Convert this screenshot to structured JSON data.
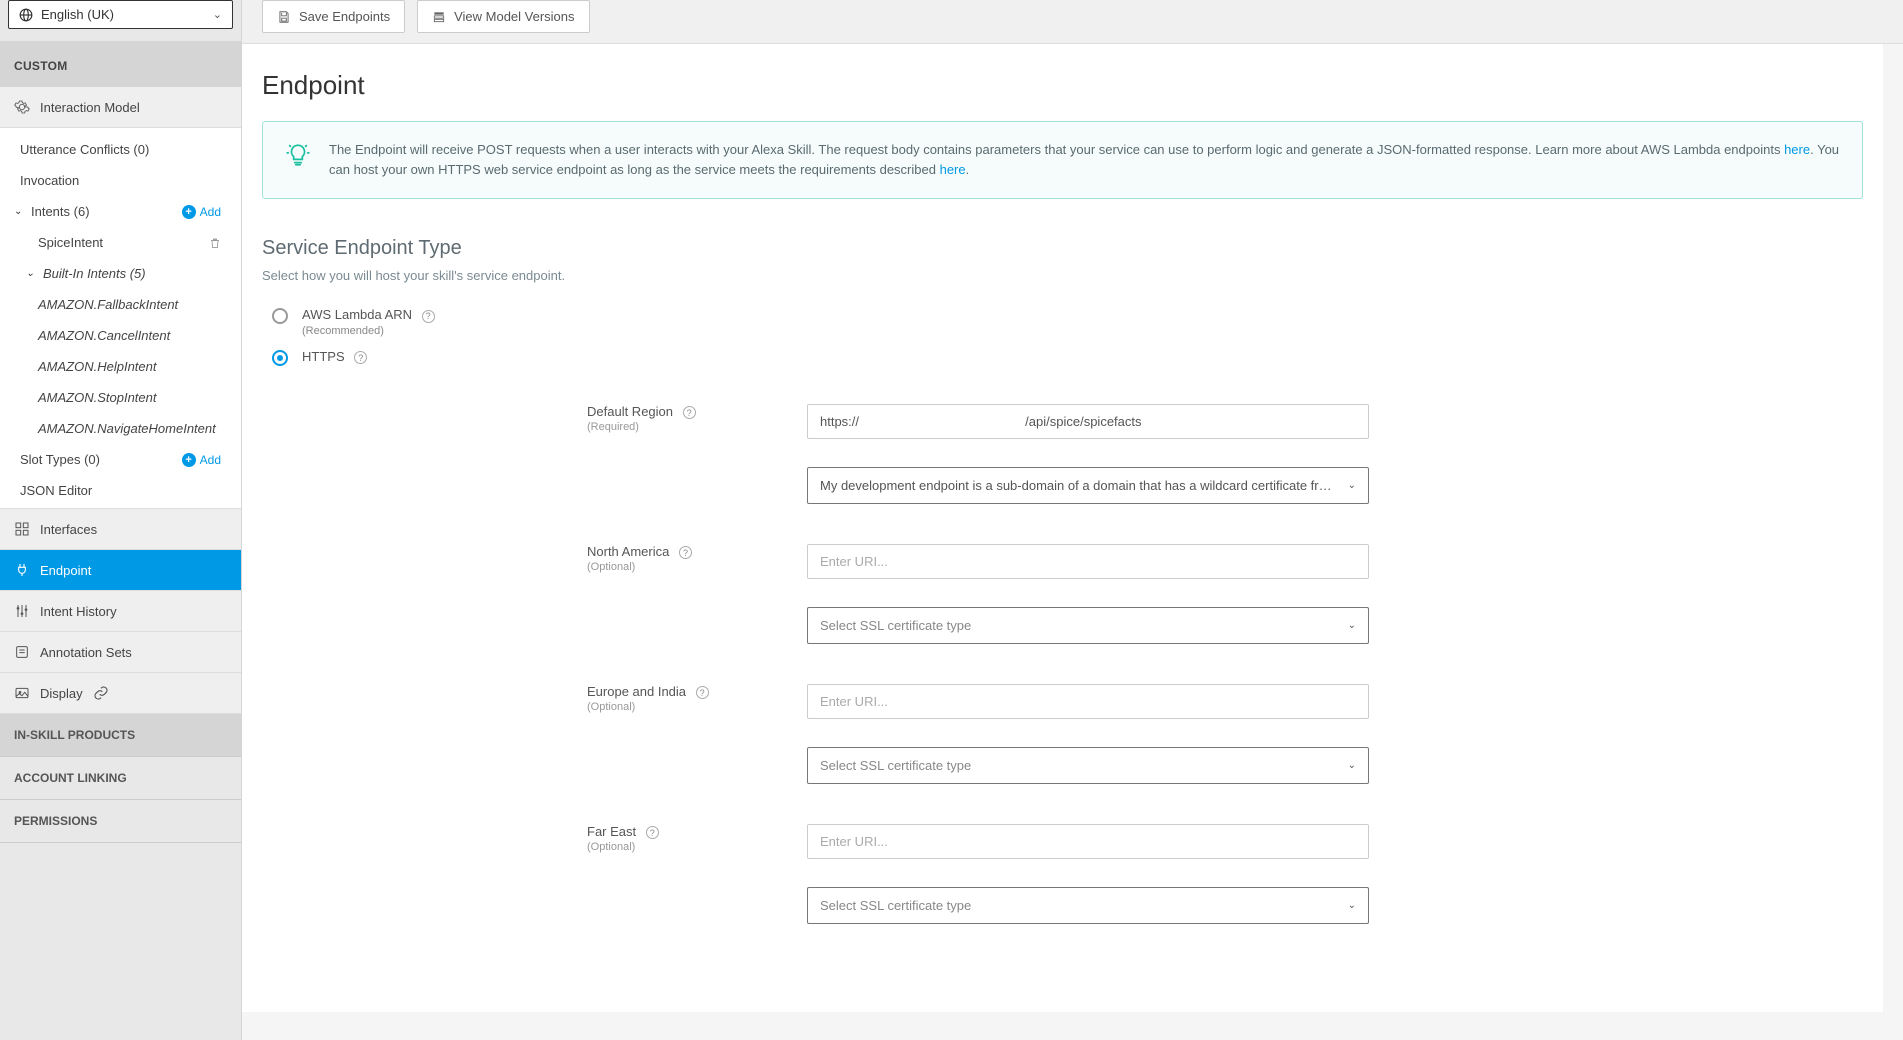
{
  "language": "English (UK)",
  "sidebar": {
    "custom_header": "CUSTOM",
    "interaction_model": "Interaction Model",
    "utterance_conflicts": "Utterance Conflicts (0)",
    "invocation": "Invocation",
    "intents_label": "Intents (6)",
    "add_label": "Add",
    "spice_intent": "SpiceIntent",
    "builtin_intents_label": "Built-In Intents (5)",
    "builtin": [
      "AMAZON.FallbackIntent",
      "AMAZON.CancelIntent",
      "AMAZON.HelpIntent",
      "AMAZON.StopIntent",
      "AMAZON.NavigateHomeIntent"
    ],
    "slot_types": "Slot Types (0)",
    "json_editor": "JSON Editor",
    "interfaces": "Interfaces",
    "endpoint": "Endpoint",
    "intent_history": "Intent History",
    "annotation_sets": "Annotation Sets",
    "display": "Display",
    "in_skill_products": "IN-SKILL PRODUCTS",
    "account_linking": "ACCOUNT LINKING",
    "permissions": "PERMISSIONS"
  },
  "toolbar": {
    "save": "Save Endpoints",
    "versions": "View Model Versions"
  },
  "page": {
    "title": "Endpoint",
    "info_pre": "The Endpoint will receive POST requests when a user interacts with your Alexa Skill. The request body contains parameters that your service can use to perform logic and generate a JSON-formatted response. Learn more about AWS Lambda endpoints ",
    "info_link1": "here",
    "info_mid": ". You can host your own HTTPS web service endpoint as long as the service meets the requirements described ",
    "info_link2": "here",
    "info_end": ".",
    "sect_title": "Service Endpoint Type",
    "sect_sub": "Select how you will host your skill's service endpoint.",
    "radio_lambda": "AWS Lambda ARN",
    "radio_lambda_reco": "(Recommended)",
    "radio_https": "HTTPS",
    "regions": {
      "default": {
        "label": "Default Region",
        "req": "(Required)",
        "value": "https://                                              /api/spice/spicefacts",
        "ssl": "My development endpoint is a sub-domain of a domain that has a wildcard certificate from a certificate autho…"
      },
      "na": {
        "label": "North America",
        "req": "(Optional)",
        "placeholder": "Enter URI...",
        "ssl": "Select SSL certificate type"
      },
      "eu": {
        "label": "Europe and India",
        "req": "(Optional)",
        "placeholder": "Enter URI...",
        "ssl": "Select SSL certificate type"
      },
      "fe": {
        "label": "Far East",
        "req": "(Optional)",
        "placeholder": "Enter URI...",
        "ssl": "Select SSL certificate type"
      }
    }
  }
}
